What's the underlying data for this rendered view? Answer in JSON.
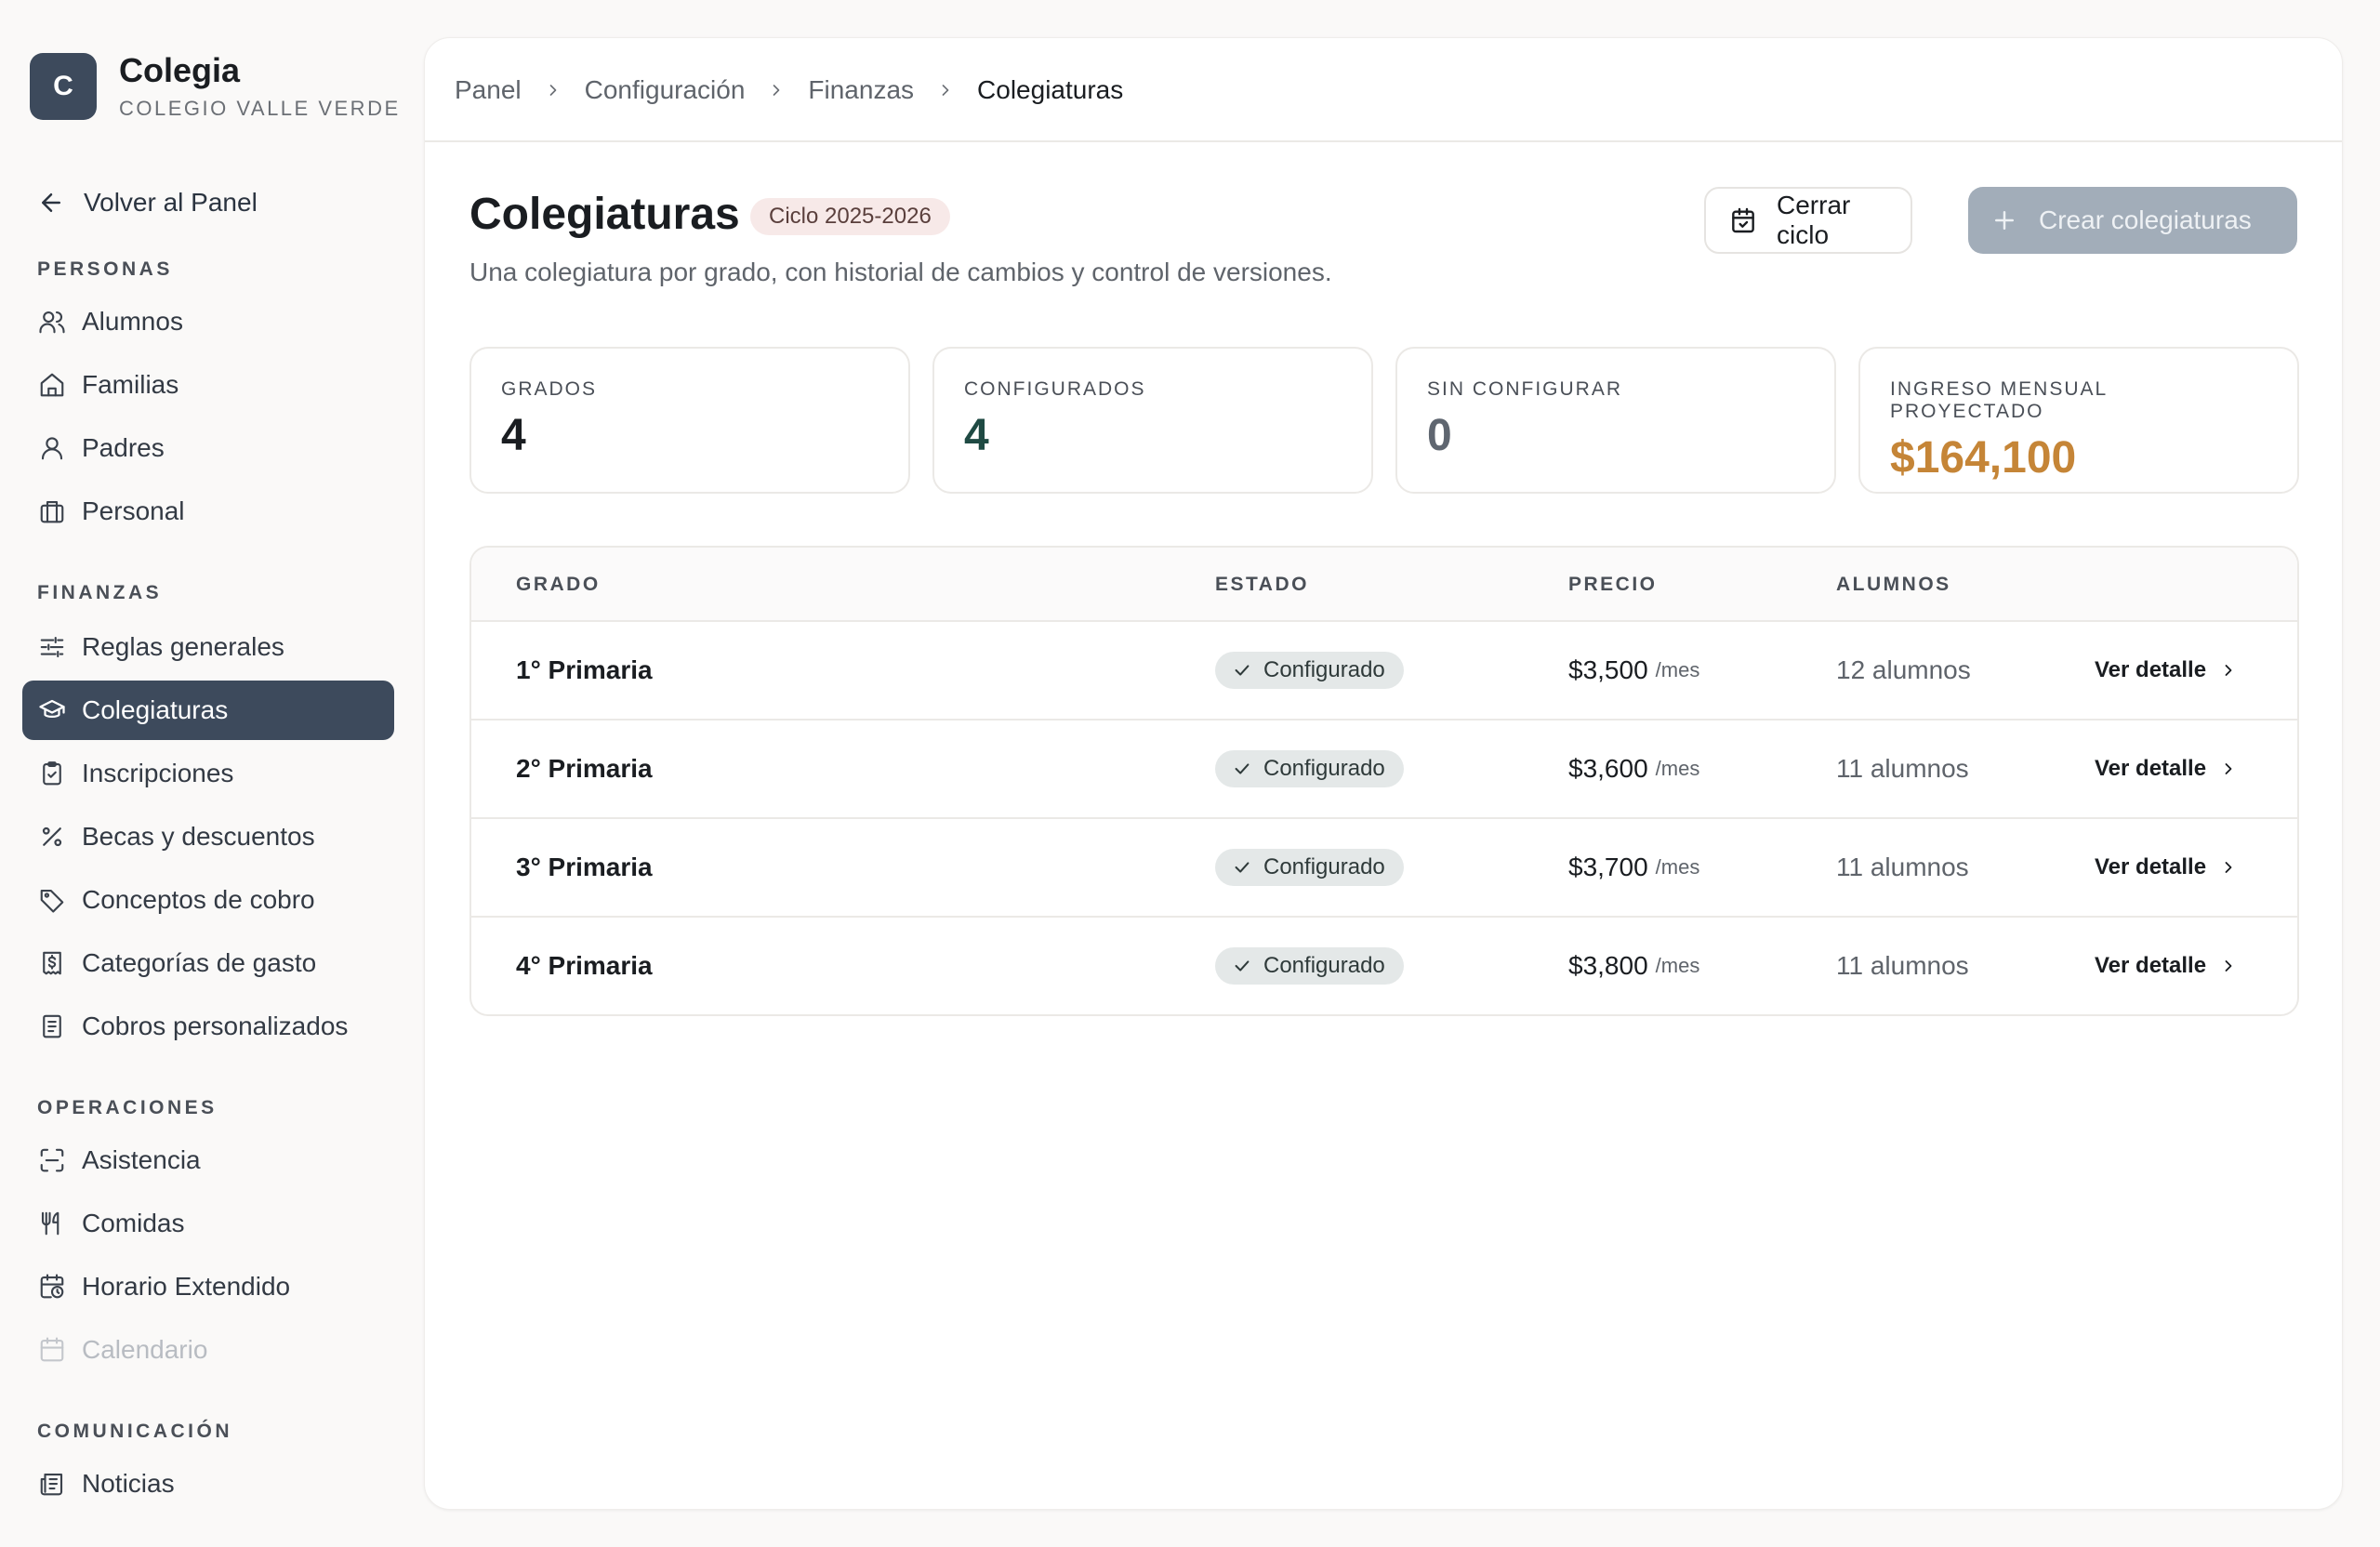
{
  "colors": {
    "brand": "#3d4a5c",
    "sidebar_active": "#3d4a5c",
    "value_green": "#1f4a43",
    "value_gray": "#5f6670",
    "value_orange": "#c58537",
    "primary_disabled": "#a2adb9",
    "status_pill": "#e4e8e8",
    "cycle_badge": "#f7e9e8"
  },
  "brand": {
    "logo_letter": "C",
    "name": "Colegia",
    "school": "COLEGIO VALLE VERDE"
  },
  "sidebar": {
    "back": {
      "label": "Volver al Panel",
      "icon": "arrow-left-icon"
    },
    "sections": [
      {
        "title": "PERSONAS",
        "items": [
          {
            "label": "Alumnos",
            "icon": "users-icon"
          },
          {
            "label": "Familias",
            "icon": "home-icon"
          },
          {
            "label": "Padres",
            "icon": "user-icon"
          },
          {
            "label": "Personal",
            "icon": "briefcase-icon"
          }
        ]
      },
      {
        "title": "FINANZAS",
        "items": [
          {
            "label": "Reglas generales",
            "icon": "sliders-icon"
          },
          {
            "label": "Colegiaturas",
            "icon": "graduation-cap-icon",
            "active": true
          },
          {
            "label": "Inscripciones",
            "icon": "clipboard-check-icon"
          },
          {
            "label": "Becas y descuentos",
            "icon": "percent-icon"
          },
          {
            "label": "Conceptos de cobro",
            "icon": "tag-icon"
          },
          {
            "label": "Categorías de gasto",
            "icon": "receipt-dollar-icon"
          },
          {
            "label": "Cobros personalizados",
            "icon": "receipt-icon"
          }
        ]
      },
      {
        "title": "OPERACIONES",
        "items": [
          {
            "label": "Asistencia",
            "icon": "scan-icon"
          },
          {
            "label": "Comidas",
            "icon": "utensils-icon"
          },
          {
            "label": "Horario Extendido",
            "icon": "calendar-clock-icon"
          },
          {
            "label": "Calendario",
            "icon": "calendar-icon",
            "disabled": true
          }
        ]
      },
      {
        "title": "COMUNICACIÓN",
        "items": [
          {
            "label": "Noticias",
            "icon": "newspaper-icon"
          }
        ]
      }
    ]
  },
  "breadcrumb": [
    "Panel",
    "Configuración",
    "Finanzas",
    "Colegiaturas"
  ],
  "header": {
    "title": "Colegiaturas",
    "cycle_badge": "Ciclo 2025-2026",
    "subtitle": "Una colegiatura por grado, con historial de cambios y control de versiones.",
    "close_cycle_label": "Cerrar ciclo",
    "create_label": "Crear colegiaturas"
  },
  "stats": [
    {
      "label": "GRADOS",
      "value": "4",
      "color": "#1a1d21"
    },
    {
      "label": "CONFIGURADOS",
      "value": "4",
      "color": "#1f4a43"
    },
    {
      "label": "SIN CONFIGURAR",
      "value": "0",
      "color": "#5f6670"
    },
    {
      "label": "INGRESO MENSUAL PROYECTADO",
      "value": "$164,100",
      "color": "#c58537"
    }
  ],
  "table": {
    "columns": [
      "GRADO",
      "ESTADO",
      "PRECIO",
      "ALUMNOS"
    ],
    "rows": [
      {
        "grade": "1° Primaria",
        "status": "Configurado",
        "price": "$3,500",
        "unit": "/mes",
        "students": "12 alumnos",
        "action": "Ver detalle"
      },
      {
        "grade": "2° Primaria",
        "status": "Configurado",
        "price": "$3,600",
        "unit": "/mes",
        "students": "11 alumnos",
        "action": "Ver detalle"
      },
      {
        "grade": "3° Primaria",
        "status": "Configurado",
        "price": "$3,700",
        "unit": "/mes",
        "students": "11 alumnos",
        "action": "Ver detalle"
      },
      {
        "grade": "4° Primaria",
        "status": "Configurado",
        "price": "$3,800",
        "unit": "/mes",
        "students": "11 alumnos",
        "action": "Ver detalle"
      }
    ]
  }
}
